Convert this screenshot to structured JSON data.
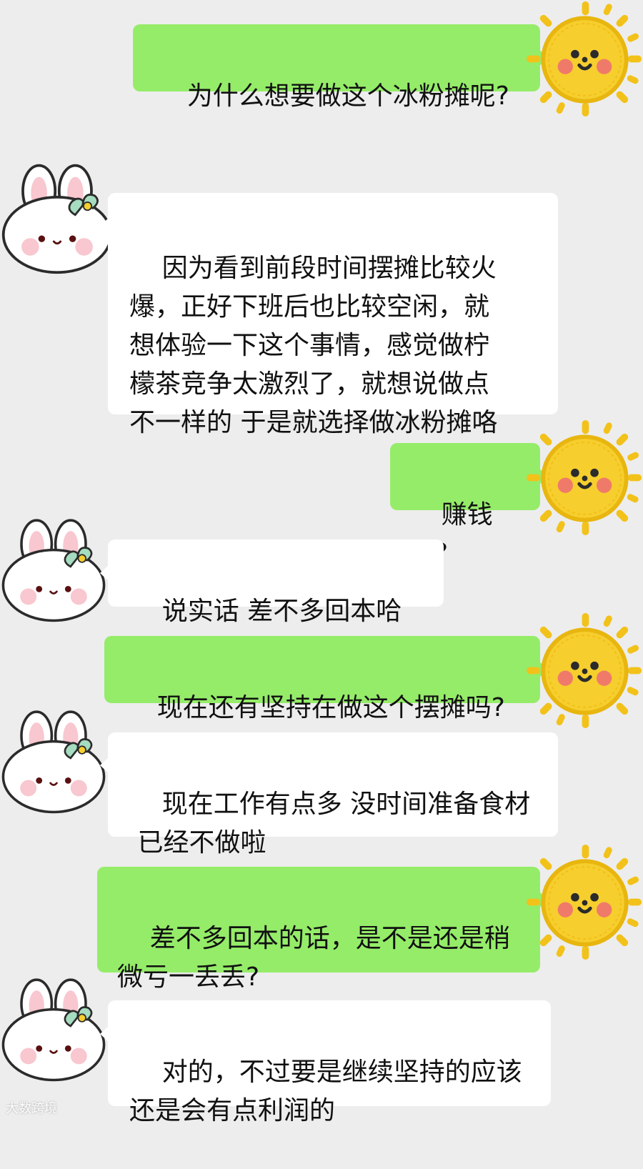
{
  "chat": {
    "messages": [
      {
        "sender": "me",
        "text": "为什么想要做这个冰粉摊呢?"
      },
      {
        "sender": "other",
        "text": "因为看到前段时间摆摊比较火\n爆，正好下班后也比较空闲，就\n想体验一下这个事情，感觉做柠\n檬茶竞争太激烈了，就想说做点\n不一样的 于是就选择做冰粉摊咯"
      },
      {
        "sender": "me",
        "text": "赚钱吗?"
      },
      {
        "sender": "other",
        "text": "说实话 差不多回本哈哈"
      },
      {
        "sender": "me",
        "text": "现在还有坚持在做这个摆摊吗?"
      },
      {
        "sender": "other",
        "text": "现在工作有点多 没时间准备食材\n 已经不做啦"
      },
      {
        "sender": "me",
        "text": "差不多回本的话，是不是还是稍\n微亏一丢丢?"
      },
      {
        "sender": "other",
        "text": "对的，不过要是继续坚持的应该\n还是会有点利润的"
      }
    ]
  },
  "avatars": {
    "me": "sun-face-avatar",
    "other": "bunny-face-avatar"
  },
  "colors": {
    "background": "#ededed",
    "outgoing_bubble": "#95ec69",
    "incoming_bubble": "#ffffff",
    "text": "#111111"
  },
  "watermark": "大数跨境"
}
